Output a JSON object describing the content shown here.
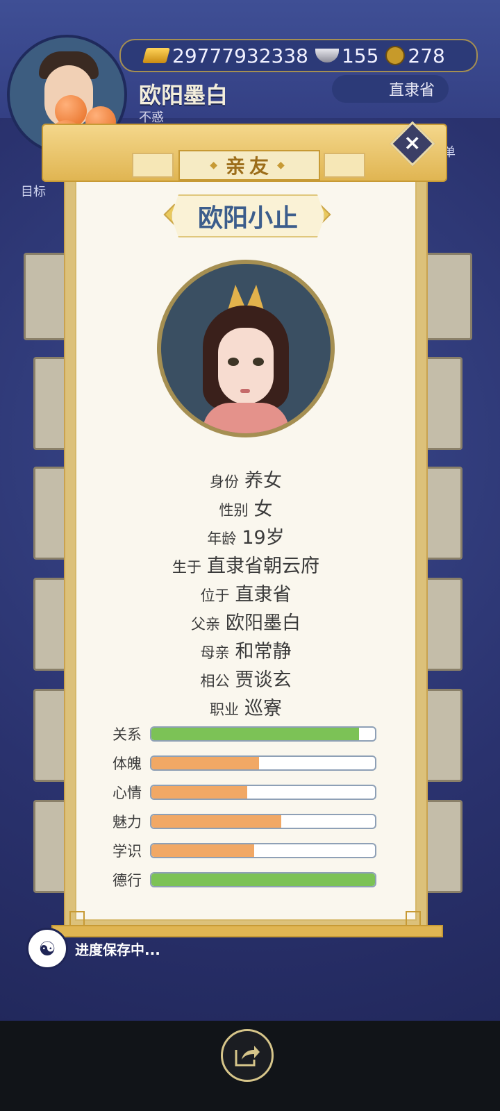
{
  "header": {
    "player_name": "欧阳墨白",
    "player_title": "不惑",
    "gold": "29777932338",
    "silver": "155",
    "coins": "278",
    "province": "直隶省",
    "goal_label": "目标",
    "menu_label": "菜单"
  },
  "modal": {
    "title": "亲友",
    "character_name": "欧阳小止",
    "info": [
      {
        "key": "身份",
        "value": "养女"
      },
      {
        "key": "性别",
        "value": "女"
      },
      {
        "key": "年龄",
        "value": "19岁"
      },
      {
        "key": "生于",
        "value": "直隶省朝云府"
      },
      {
        "key": "位于",
        "value": "直隶省"
      },
      {
        "key": "父亲",
        "value": "欧阳墨白"
      },
      {
        "key": "母亲",
        "value": "和常静"
      },
      {
        "key": "相公",
        "value": "贾谈玄"
      },
      {
        "key": "职业",
        "value": "巡寮"
      }
    ],
    "stats": [
      {
        "label": "关系",
        "level": 0.93,
        "color": "#7cc256"
      },
      {
        "label": "体魄",
        "level": 0.48,
        "color": "#f1a865"
      },
      {
        "label": "心情",
        "level": 0.43,
        "color": "#f1a865"
      },
      {
        "label": "魅力",
        "level": 0.58,
        "color": "#f1a865"
      },
      {
        "label": "学识",
        "level": 0.46,
        "color": "#f1a865"
      },
      {
        "label": "德行",
        "level": 1.0,
        "color": "#7cc256"
      }
    ]
  },
  "status": {
    "saving_text": "进度保存中..."
  },
  "icons": {
    "close": "close-icon",
    "share": "share-icon",
    "save": "dragon-emblem-icon"
  }
}
